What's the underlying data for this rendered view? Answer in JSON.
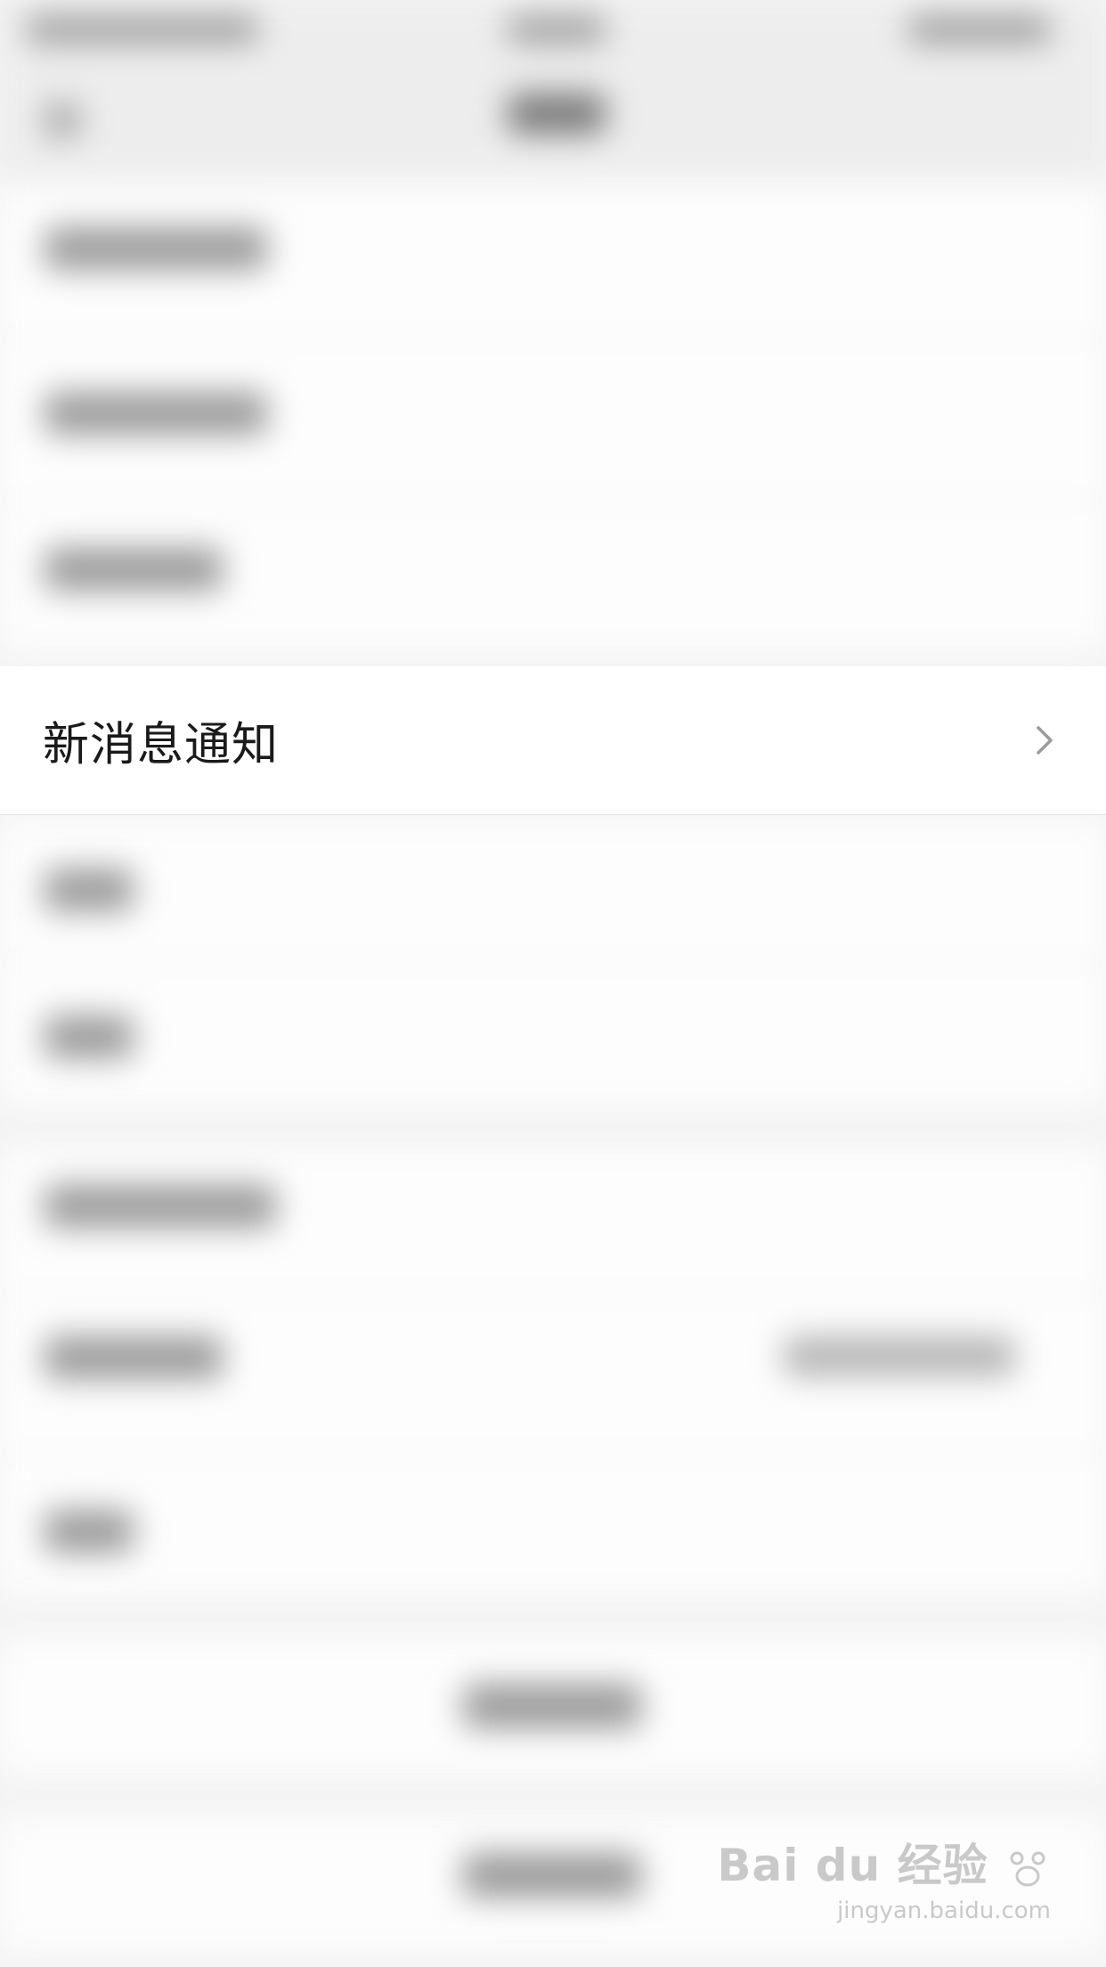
{
  "focus_row": {
    "label": "新消息通知",
    "icon": "chevron-right-icon"
  },
  "watermark": {
    "logo_text": "Bai du 经验",
    "sub": "jingyan.baidu.com"
  },
  "colors": {
    "background": "#f4f4f4",
    "row": "#ffffff",
    "text": "#1a1a1a",
    "chevron": "#9b9b9b"
  }
}
